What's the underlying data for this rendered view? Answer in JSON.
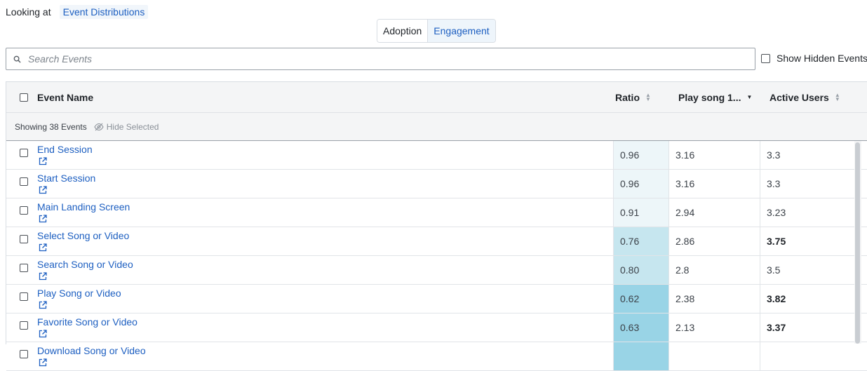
{
  "header": {
    "looking_label": "Looking at",
    "distribution_label": "Event Distributions"
  },
  "view_toggle": {
    "adoption": "Adoption",
    "engagement": "Engagement"
  },
  "search": {
    "placeholder": "Search Events",
    "value": ""
  },
  "hidden_events": {
    "label": "Show Hidden Events"
  },
  "table": {
    "columns": {
      "event_name": "Event Name",
      "ratio": "Ratio",
      "play_song": "Play song 1...",
      "active_users": "Active Users"
    },
    "showing": "Showing 38 Events",
    "hide_selected": "Hide Selected",
    "rows": [
      {
        "name": "End Session",
        "ratio": "0.96",
        "play": "3.16",
        "active": "3.3",
        "ratio_level": 0.96,
        "active_bold": false
      },
      {
        "name": "Start Session",
        "ratio": "0.96",
        "play": "3.16",
        "active": "3.3",
        "ratio_level": 0.96,
        "active_bold": false
      },
      {
        "name": "Main Landing Screen",
        "ratio": "0.91",
        "play": "2.94",
        "active": "3.23",
        "ratio_level": 0.91,
        "active_bold": false
      },
      {
        "name": "Select Song or Video",
        "ratio": "0.76",
        "play": "2.86",
        "active": "3.75",
        "ratio_level": 0.76,
        "active_bold": true
      },
      {
        "name": "Search Song or Video",
        "ratio": "0.80",
        "play": "2.8",
        "active": "3.5",
        "ratio_level": 0.8,
        "active_bold": false
      },
      {
        "name": "Play Song or Video",
        "ratio": "0.62",
        "play": "2.38",
        "active": "3.82",
        "ratio_level": 0.62,
        "active_bold": true
      },
      {
        "name": "Favorite Song or Video",
        "ratio": "0.63",
        "play": "2.13",
        "active": "3.37",
        "ratio_level": 0.63,
        "active_bold": true
      },
      {
        "name": "Download Song or Video",
        "ratio": "",
        "play": "",
        "active": "",
        "ratio_level": 0.7,
        "active_bold": false
      }
    ]
  },
  "colors": {
    "accent": "#1d5fc1",
    "ratio_high": "#edf6f9",
    "ratio_mid": "#c6e6ef",
    "ratio_low": "#99d4e6"
  }
}
